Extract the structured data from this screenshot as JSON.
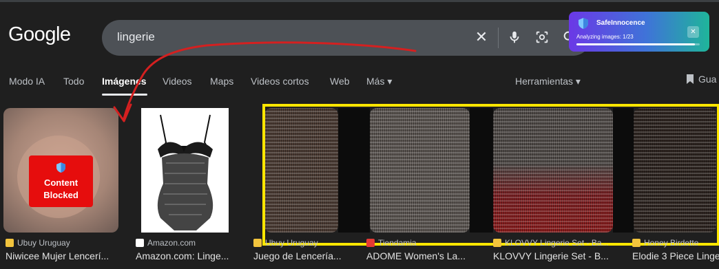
{
  "header": {
    "logo": "Google",
    "search_query": "lingerie"
  },
  "extension": {
    "name": "SafeInnocence",
    "status": "Analyzing images: 1/23",
    "progress_fraction": 0.96,
    "close_label": "✕"
  },
  "tabs": [
    {
      "label": "Modo IA"
    },
    {
      "label": "Todo"
    },
    {
      "label": "Imágenes",
      "active": true
    },
    {
      "label": "Videos"
    },
    {
      "label": "Maps"
    },
    {
      "label": "Videos cortos"
    },
    {
      "label": "Web"
    },
    {
      "label": "Más ▾"
    }
  ],
  "tools_label": "Herramientas ▾",
  "save_label": "Gua",
  "blocked_overlay": {
    "line1": "Content",
    "line2": "Blocked"
  },
  "results": [
    {
      "source": "Ubuy Uruguay",
      "title": "Niwicee Mujer Lencerí..."
    },
    {
      "source": "Amazon.com",
      "title": "Amazon.com: Linge..."
    },
    {
      "source": "Ubuy Uruguay",
      "title": "Juego de Lencería..."
    },
    {
      "source": "Tiendamia",
      "title": "ADOME Women's La..."
    },
    {
      "source": "KLOVVY Lingerie Set - Ba...",
      "title": "KLOVVY Lingerie Set - B..."
    },
    {
      "source": "Honey Birdette",
      "title": "Elodie 3 Piece Linge"
    }
  ],
  "colors": {
    "background": "#1f1f1f",
    "search_bar": "#4d5156",
    "blocked_red": "#e60d0d",
    "highlight_yellow": "#ffe600",
    "annotation_red": "#d42020"
  }
}
